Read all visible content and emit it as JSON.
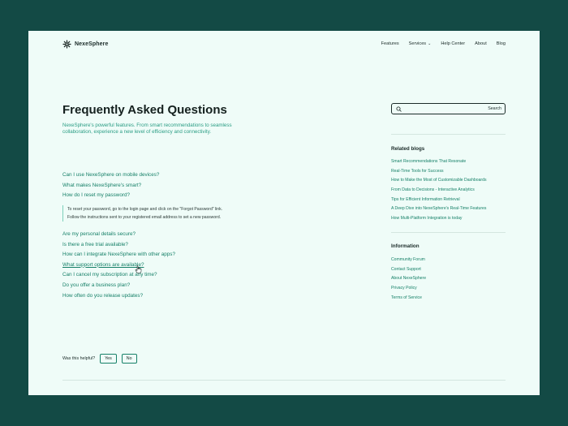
{
  "brand": {
    "name": "NexeSphere"
  },
  "nav": {
    "features": "Features",
    "services": "Services",
    "help_center": "Help Center",
    "about": "About",
    "blog": "Blog"
  },
  "page": {
    "title": "Frequently Asked Questions",
    "subtitle": "NexeSphere's powerful features. From smart recommendations to seamless collaboration, experience a new level of efficiency and connectivity."
  },
  "faqs_top": [
    "Can I use NexeSphere on mobile devices?",
    "What makes NexeSphere's smart?",
    "How do I reset my password?"
  ],
  "answer": {
    "line1": "To reset your password, go to the login page and click on the \"Forgot Password\" link.",
    "line2": "Follow the instructions sent to your registered email address to set a new password."
  },
  "faqs_bottom": [
    "Are my personal details secure?",
    "Is there a free trial available?",
    "How can I integrate NexeSphere with other apps?",
    "What support options are available?",
    "Can I cancel my subscription at any time?",
    "Do you offer a business plan?",
    "How often do you release updates?"
  ],
  "feedback": {
    "label": "Was this helpful?",
    "yes": "Yes",
    "no": "No"
  },
  "search": {
    "placeholder": "",
    "button": "Search"
  },
  "related": {
    "heading": "Related blogs",
    "items": [
      "Smart Recommendations That Resonate",
      "Real-Time Tools for Success",
      "How to Make the Most of Customizable Dashboards",
      "From Data to Decisions - Interactive Analytics",
      "Tips for Efficient Information Retrieval",
      "A Deep Dive into NexeSphere's Real-Time Features",
      "How Multi-Platform Integration is today"
    ]
  },
  "information": {
    "heading": "Information",
    "items": [
      "Community Forum",
      "Contact Support",
      "About NexeSphere",
      "Privacy Policy",
      "Terms of Service"
    ]
  },
  "colors": {
    "background": "#134a45",
    "surface": "#effcf8",
    "accent": "#168068",
    "text": "#15211f"
  },
  "icons": [
    "sunburst-logo-icon",
    "chevron-down-icon",
    "search-icon",
    "hand-pointer-cursor-icon"
  ]
}
